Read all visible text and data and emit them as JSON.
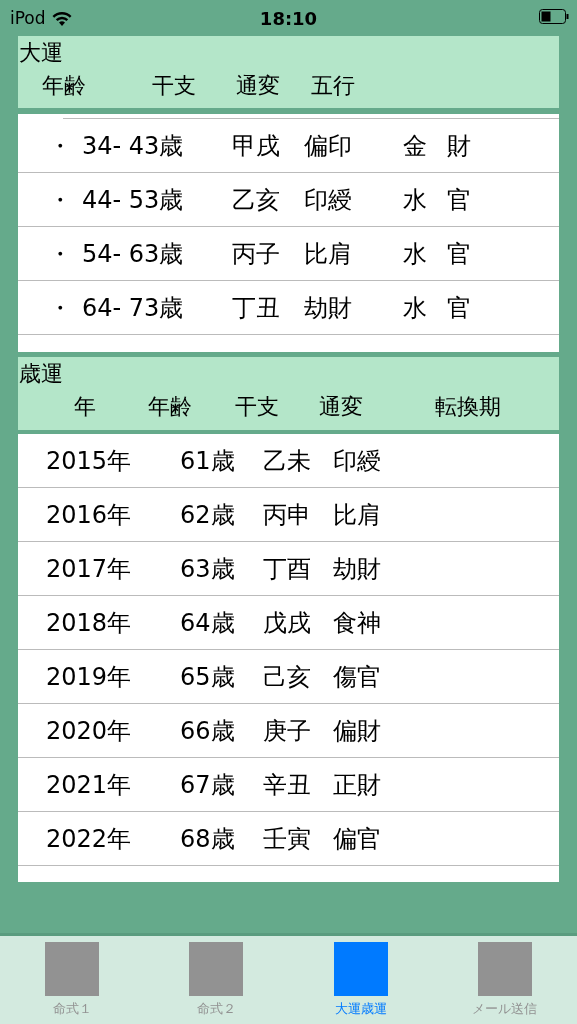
{
  "status_bar": {
    "carrier": "iPod",
    "time": "18:10"
  },
  "daiun": {
    "title": "大運",
    "columns": [
      "年齢",
      "干支",
      "通変",
      "五行"
    ],
    "rows": [
      {
        "bullet": "・",
        "age": "34- 43歳",
        "kanshi": "甲戌",
        "tsuhen": "偏印",
        "gogyo": "金",
        "column_5": "財"
      },
      {
        "bullet": "・",
        "age": "44- 53歳",
        "kanshi": "乙亥",
        "tsuhen": "印綬",
        "gogyo": "水",
        "column_5": "官"
      },
      {
        "bullet": "・",
        "age": "54- 63歳",
        "kanshi": "丙子",
        "tsuhen": "比肩",
        "gogyo": "水",
        "column_5": "官"
      },
      {
        "bullet": "・",
        "age": "64- 73歳",
        "kanshi": "丁丑",
        "tsuhen": "劫財",
        "gogyo": "水",
        "column_5": "官"
      }
    ]
  },
  "saiun": {
    "title": "歳運",
    "columns": [
      "年",
      "年齢",
      "干支",
      "通変",
      "転換期"
    ],
    "rows": [
      {
        "year": "2015年",
        "age": "61歳",
        "kanshi": "乙未",
        "tsuhen": "印綬"
      },
      {
        "year": "2016年",
        "age": "62歳",
        "kanshi": "丙申",
        "tsuhen": "比肩"
      },
      {
        "year": "2017年",
        "age": "63歳",
        "kanshi": "丁酉",
        "tsuhen": "劫財"
      },
      {
        "year": "2018年",
        "age": "64歳",
        "kanshi": "戊戌",
        "tsuhen": "食神"
      },
      {
        "year": "2019年",
        "age": "65歳",
        "kanshi": "己亥",
        "tsuhen": "傷官"
      },
      {
        "year": "2020年",
        "age": "66歳",
        "kanshi": "庚子",
        "tsuhen": "偏財"
      },
      {
        "year": "2021年",
        "age": "67歳",
        "kanshi": "辛丑",
        "tsuhen": "正財"
      },
      {
        "year": "2022年",
        "age": "68歳",
        "kanshi": "壬寅",
        "tsuhen": "偏官"
      }
    ]
  },
  "tabs": [
    {
      "label": "命式１",
      "selected": false
    },
    {
      "label": "命式２",
      "selected": false
    },
    {
      "label": "大運歳運",
      "selected": true
    },
    {
      "label": "メール送信",
      "selected": false
    }
  ]
}
